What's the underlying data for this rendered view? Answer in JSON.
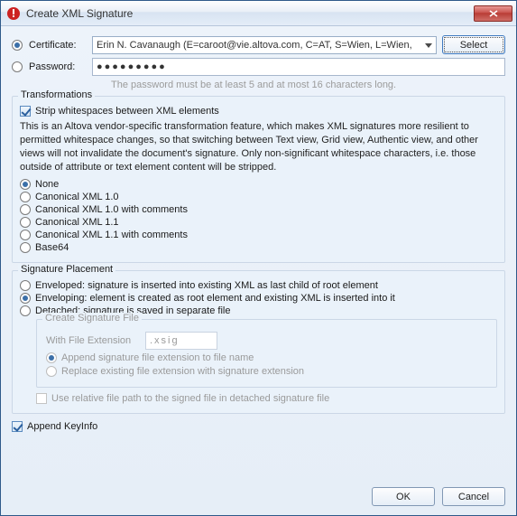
{
  "window": {
    "title": "Create XML Signature"
  },
  "auth": {
    "certificate_label": "Certificate:",
    "certificate_value": "Erin N. Cavanaugh (E=caroot@vie.altova.com, C=AT, S=Wien, L=Wien,",
    "select_btn": "Select",
    "password_label": "Password:",
    "password_value": "●●●●●●●●●",
    "password_hint": "The password must be at least 5 and at most 16 characters long."
  },
  "transform": {
    "title": "Transformations",
    "strip_label": "Strip whitespaces between XML elements",
    "desc": "This is an Altova vendor-specific transformation feature, which makes XML signatures more resilient to permitted whitespace changes, so that switching between Text view, Grid view, Authentic view, and other views will not invalidate the document's signature. Only non-significant whitespace characters, i.e. those outside of attribute or text element content will be stripped.",
    "opts": [
      "None",
      "Canonical XML 1.0",
      "Canonical XML 1.0 with comments",
      "Canonical XML 1.1",
      "Canonical XML 1.1 with comments",
      "Base64"
    ]
  },
  "placement": {
    "title": "Signature Placement",
    "enveloped": "Enveloped: signature is inserted into existing XML as last child of root element",
    "enveloping": "Enveloping: element is created as root element and existing XML is inserted into it",
    "detached": "Detached: signature is saved in separate file",
    "createfile": {
      "title": "Create Signature File",
      "ext_label": "With File Extension",
      "ext_value": ".xsig",
      "append": "Append signature file extension to file name",
      "replace": "Replace existing file extension with signature extension"
    },
    "relative": "Use relative file path to the signed file in detached signature file"
  },
  "append_keyinfo": "Append KeyInfo",
  "buttons": {
    "ok": "OK",
    "cancel": "Cancel"
  }
}
